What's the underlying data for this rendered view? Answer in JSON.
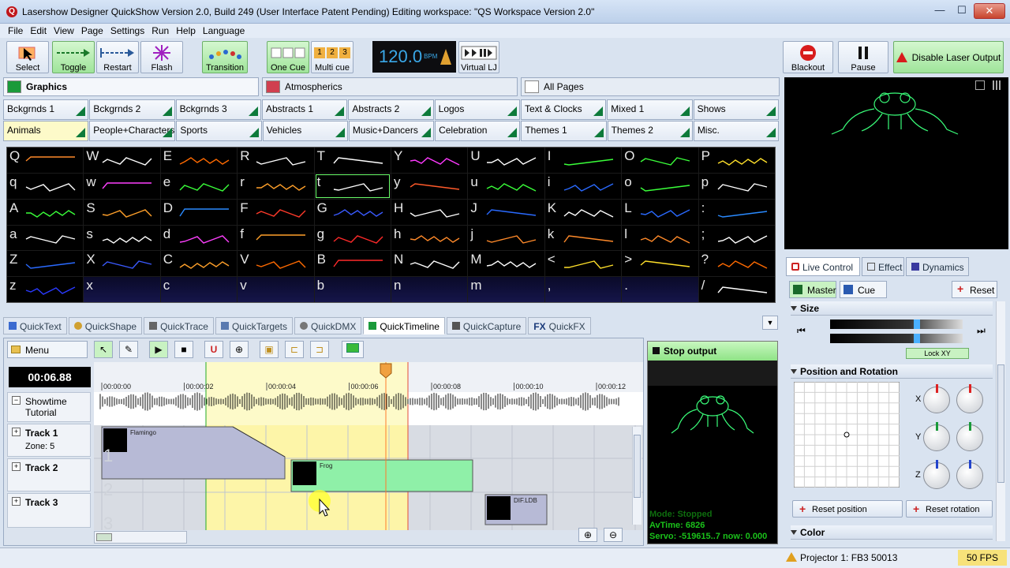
{
  "window": {
    "title": "Lasershow Designer QuickShow   Version 2.0, Build 249   (User Interface Patent Pending)   Editing workspace: \"QS Workspace Version 2.0\"",
    "app_icon": "Q",
    "min": "—",
    "max": "☐",
    "close": "✕"
  },
  "menu": [
    "File",
    "Edit",
    "View",
    "Page",
    "Settings",
    "Run",
    "Help",
    "Language"
  ],
  "toolbar": {
    "select": "Select",
    "toggle": "Toggle",
    "restart": "Restart",
    "flash": "Flash",
    "transition": "Transition",
    "one_cue": "One Cue",
    "multi_cue": "Multi cue",
    "bpm_value": "120.0",
    "bpm_unit": "BPM",
    "virtual_lj": "Virtual LJ",
    "blackout": "Blackout",
    "pause": "Pause",
    "disable_laser": "Disable Laser Output",
    "multi_digits": [
      "1",
      "2",
      "3"
    ]
  },
  "pages": [
    {
      "label": "Graphics",
      "color": "#1a9a3a"
    },
    {
      "label": "Atmospherics",
      "color": "#d04050"
    },
    {
      "label": "All Pages",
      "color": "#ffffff"
    }
  ],
  "categories_row1": [
    "Bckgrnds 1",
    "Bckgrnds 2",
    "Bckgrnds 3",
    "Abstracts 1",
    "Abstracts 2",
    "Logos",
    "Text & Clocks",
    "Mixed 1",
    "Shows"
  ],
  "categories_row2": [
    "Animals",
    "People+Characters",
    "Sports",
    "Vehicles",
    "Music+Dancers",
    "Celebration",
    "Themes 1",
    "Themes 2",
    "Misc."
  ],
  "grid_keys": [
    [
      "Q",
      "W",
      "E",
      "R",
      "T",
      "Y",
      "U",
      "I",
      "O",
      "P"
    ],
    [
      "q",
      "w",
      "e",
      "r",
      "t",
      "y",
      "u",
      "i",
      "o",
      "p"
    ],
    [
      "A",
      "S",
      "D",
      "F",
      "G",
      "H",
      "J",
      "K",
      "L",
      ":"
    ],
    [
      "a",
      "s",
      "d",
      "f",
      "g",
      "h",
      "j",
      "k",
      "l",
      ";"
    ],
    [
      "Z",
      "X",
      "C",
      "V",
      "B",
      "N",
      "M",
      "<",
      ">",
      "?"
    ],
    [
      "z",
      "x",
      "c",
      "v",
      "b",
      "n",
      "m",
      ",",
      ".",
      "/"
    ]
  ],
  "grid_art_colors": [
    [
      "#ff8a2a",
      "#ffffff",
      "#ff6a00",
      "#ffffff",
      "#ffffff",
      "#ff3aff",
      "#ffffff",
      "#3aff3a",
      "#3aff3a",
      "#ffe02a"
    ],
    [
      "#ffffff",
      "#ff40ff",
      "#3aff3a",
      "#ffa02a",
      "#ffffff",
      "#ff5a2a",
      "#3aff3a",
      "#2a6aff",
      "#3aff3a",
      "#ffffff"
    ],
    [
      "#3aff3a",
      "#ffa02a",
      "#2a8aff",
      "#ff3a2a",
      "#3a5aff",
      "#ffffff",
      "#2a6aff",
      "#ffffff",
      "#2a6aff",
      "#2a8aff"
    ],
    [
      "#ffffff",
      "#ffffff",
      "#ff40ff",
      "#ffa02a",
      "#ff2a2a",
      "#ff8a2a",
      "#ff8a2a",
      "#ff8a2a",
      "#ff8a2a",
      "#ffffff"
    ],
    [
      "#2a6aff",
      "#3a5aff",
      "#ffa02a",
      "#ff6a00",
      "#ff2a2a",
      "#ffffff",
      "#ffffff",
      "#ffe02a",
      "#ffe02a",
      "#ff6a00"
    ],
    [
      "#2a3aff",
      "#ffffff",
      "#ffffff",
      "#ffffff",
      "#ffffff",
      "#ffffff",
      "#ffffff",
      "#ffffff",
      "#ffffff",
      "#ffffff"
    ]
  ],
  "grid_dark_cells_row6": [
    1,
    2,
    3,
    4,
    5,
    6,
    7,
    8
  ],
  "quicktabs": [
    "QuickText",
    "QuickShape",
    "QuickTrace",
    "QuickTargets",
    "QuickDMX",
    "QuickTimeline",
    "QuickCapture",
    "QuickFX"
  ],
  "quicktab_icon_text": "FX",
  "timeline": {
    "menu": "Menu",
    "time_display": "00:06.88",
    "ticks": [
      "00:00:00",
      "00:00:02",
      "00:00:04",
      "00:00:06",
      "00:00:08",
      "00:00:10",
      "00:00:12"
    ],
    "showtime_label": "Showtime Tutorial",
    "tracks": [
      {
        "label": "Track 1",
        "zone": "Zone: 5",
        "num": "1"
      },
      {
        "label": "Track 2",
        "zone": "",
        "num": "2"
      },
      {
        "label": "Track 3",
        "zone": "",
        "num": "3"
      }
    ],
    "clips": [
      {
        "name": "Flamingo",
        "track": 0
      },
      {
        "name": "Frog",
        "track": 1
      },
      {
        "name": "DIF.LDB",
        "track": 2
      }
    ]
  },
  "stop_output": {
    "label": "Stop output",
    "mode": "Mode:  Stopped",
    "avtime": "AvTime: 6826",
    "servo": "Servo: -519615..7 now: 0.000"
  },
  "right_panel": {
    "tabs": [
      "Live Control",
      "Effect",
      "Dynamics"
    ],
    "master": "Master",
    "cue": "Cue",
    "reset": "Reset",
    "size": "Size",
    "lock_xy": "Lock XY",
    "position_rotation": "Position and Rotation",
    "axes": [
      "X",
      "Y",
      "Z"
    ],
    "reset_position": "Reset position",
    "reset_rotation": "Reset rotation",
    "color": "Color"
  },
  "status": {
    "projector": "Projector 1: FB3 50013",
    "fps": "50 FPS"
  },
  "colors": {
    "accent_green": "#8fe386",
    "laser_green": "#3aff7a",
    "bpm_blue": "#3aa8e8",
    "playhead": "#ff3a2a"
  }
}
